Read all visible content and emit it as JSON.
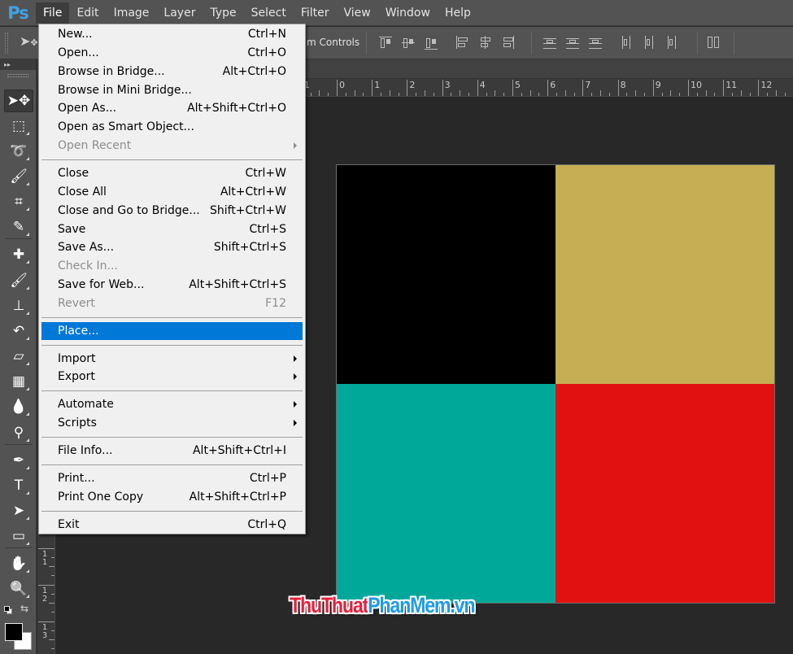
{
  "app": {
    "logo": "Ps",
    "menus": [
      "File",
      "Edit",
      "Image",
      "Layer",
      "Type",
      "Select",
      "Filter",
      "View",
      "Window",
      "Help"
    ],
    "active_menu": "File"
  },
  "options_bar": {
    "transform_controls_label": "m Controls",
    "tool_icon": "move-tool-icon",
    "align_icons": [
      "align-top-edges-icon",
      "align-vertical-centers-icon",
      "align-bottom-edges-icon",
      "align-left-edges-icon",
      "align-horizontal-centers-icon",
      "align-right-edges-icon",
      "distribute-top-edges-icon",
      "distribute-vertical-centers-icon",
      "distribute-bottom-edges-icon",
      "distribute-left-edges-icon",
      "distribute-horizontal-centers-icon",
      "distribute-right-edges-icon",
      "auto-align-layers-icon"
    ]
  },
  "tools_panel": {
    "collapse_glyph": "▸▸",
    "tools": [
      {
        "name": "move-tool",
        "glyph": "➤✥",
        "selected": true
      },
      {
        "name": "rectangular-marquee-tool",
        "glyph": "⬚"
      },
      {
        "name": "lasso-tool",
        "glyph": "➰"
      },
      {
        "name": "quick-selection-tool",
        "glyph": "🖌"
      },
      {
        "name": "crop-tool",
        "glyph": "⌗"
      },
      {
        "name": "eyedropper-tool",
        "glyph": "✎"
      },
      {
        "name": "spot-healing-brush-tool",
        "glyph": "✚"
      },
      {
        "name": "brush-tool",
        "glyph": "🖌"
      },
      {
        "name": "clone-stamp-tool",
        "glyph": "⊥"
      },
      {
        "name": "history-brush-tool",
        "glyph": "↶"
      },
      {
        "name": "eraser-tool",
        "glyph": "▱"
      },
      {
        "name": "gradient-tool",
        "glyph": "▦"
      },
      {
        "name": "blur-tool",
        "glyph": "💧"
      },
      {
        "name": "dodge-tool",
        "glyph": "⚲"
      },
      {
        "name": "pen-tool",
        "glyph": "✒"
      },
      {
        "name": "type-tool",
        "glyph": "T"
      },
      {
        "name": "path-selection-tool",
        "glyph": "➤"
      },
      {
        "name": "rectangle-tool",
        "glyph": "▭"
      },
      {
        "name": "hand-tool",
        "glyph": "✋"
      },
      {
        "name": "zoom-tool",
        "glyph": "🔍"
      }
    ],
    "foreground_color": "#000000",
    "background_color": "#ffffff",
    "swap_glyph": "⇆"
  },
  "rulers": {
    "top_labels": [
      "1",
      "0",
      "1",
      "2",
      "3",
      "4",
      "5",
      "6",
      "7",
      "8",
      "9",
      "10",
      "11",
      "12"
    ],
    "left_labels": [
      "11",
      "12",
      "13"
    ]
  },
  "canvas": {
    "quadrants": [
      {
        "name": "top-left",
        "color": "#000000"
      },
      {
        "name": "top-right",
        "color": "#c6ae55"
      },
      {
        "name": "bottom-left",
        "color": "#00a89a"
      },
      {
        "name": "bottom-right",
        "color": "#e11111"
      }
    ]
  },
  "watermark": {
    "part1": "ThuThuat",
    "part2": "PhanMem",
    "part3": ".vn",
    "color1": "#e8203c",
    "color2": "#1e9be6"
  },
  "file_menu": {
    "items": [
      {
        "label": "New...",
        "shortcut": "Ctrl+N"
      },
      {
        "label": "Open...",
        "shortcut": "Ctrl+O"
      },
      {
        "label": "Browse in Bridge...",
        "shortcut": "Alt+Ctrl+O"
      },
      {
        "label": "Browse in Mini Bridge...",
        "shortcut": ""
      },
      {
        "label": "Open As...",
        "shortcut": "Alt+Shift+Ctrl+O"
      },
      {
        "label": "Open as Smart Object...",
        "shortcut": ""
      },
      {
        "label": "Open Recent",
        "shortcut": "",
        "submenu": true,
        "disabled": true
      },
      {
        "separator": true
      },
      {
        "label": "Close",
        "shortcut": "Ctrl+W"
      },
      {
        "label": "Close All",
        "shortcut": "Alt+Ctrl+W"
      },
      {
        "label": "Close and Go to Bridge...",
        "shortcut": "Shift+Ctrl+W"
      },
      {
        "label": "Save",
        "shortcut": "Ctrl+S"
      },
      {
        "label": "Save As...",
        "shortcut": "Shift+Ctrl+S"
      },
      {
        "label": "Check In...",
        "shortcut": "",
        "disabled": true
      },
      {
        "label": "Save for Web...",
        "shortcut": "Alt+Shift+Ctrl+S"
      },
      {
        "label": "Revert",
        "shortcut": "F12",
        "disabled": true
      },
      {
        "separator": true
      },
      {
        "label": "Place...",
        "shortcut": "",
        "highlighted": true
      },
      {
        "separator": true
      },
      {
        "label": "Import",
        "shortcut": "",
        "submenu": true
      },
      {
        "label": "Export",
        "shortcut": "",
        "submenu": true
      },
      {
        "separator": true
      },
      {
        "label": "Automate",
        "shortcut": "",
        "submenu": true
      },
      {
        "label": "Scripts",
        "shortcut": "",
        "submenu": true
      },
      {
        "separator": true
      },
      {
        "label": "File Info...",
        "shortcut": "Alt+Shift+Ctrl+I"
      },
      {
        "separator": true
      },
      {
        "label": "Print...",
        "shortcut": "Ctrl+P"
      },
      {
        "label": "Print One Copy",
        "shortcut": "Alt+Shift+Ctrl+P"
      },
      {
        "separator": true
      },
      {
        "label": "Exit",
        "shortcut": "Ctrl+Q"
      }
    ]
  }
}
